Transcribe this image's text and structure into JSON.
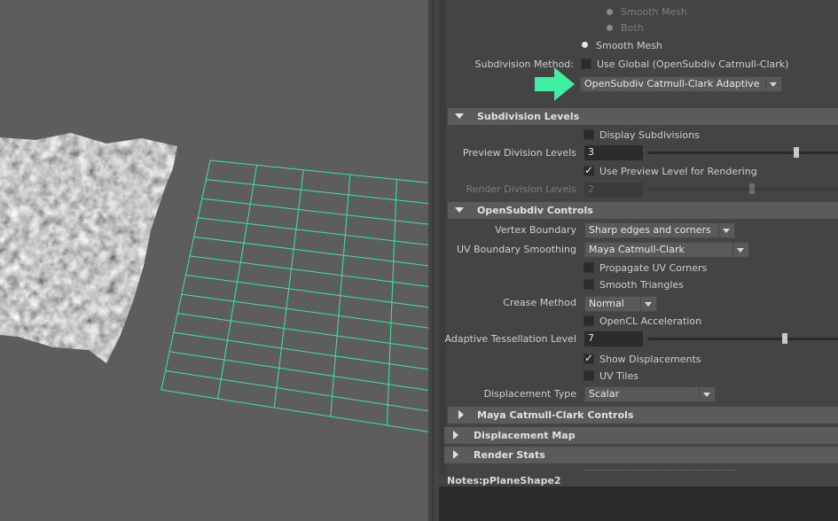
{
  "colors": {
    "wireframe": "#3de6a0",
    "arrow": "#3ff0a0",
    "viewport_bg": "#5d5d5d",
    "panel_bg": "#444444"
  },
  "top_options": {
    "smooth_mesh_dim": "Smooth Mesh",
    "both_dim": "Both",
    "smooth_mesh": "Smooth Mesh"
  },
  "subdivision_method": {
    "label": "Subdivision Method:",
    "use_global_label": "Use Global (OpenSubdiv Catmull-Clark)",
    "use_global_checked": false,
    "selected": "OpenSubdiv Catmull-Clark Adaptive"
  },
  "subdivision_levels": {
    "title": "Subdivision Levels",
    "display_subdivisions_label": "Display Subdivisions",
    "display_subdivisions_checked": false,
    "preview_label": "Preview Division Levels",
    "preview_value": "3",
    "preview_slider_fraction": 0.78,
    "use_preview_label": "Use Preview Level for Rendering",
    "use_preview_checked": true,
    "render_label": "Render Division Levels",
    "render_value": "2",
    "render_slider_fraction": 0.55
  },
  "opensubdiv_controls": {
    "title": "OpenSubdiv Controls",
    "vertex_boundary_label": "Vertex Boundary",
    "vertex_boundary_value": "Sharp edges and corners",
    "uv_boundary_label": "UV Boundary Smoothing",
    "uv_boundary_value": "Maya Catmull-Clark",
    "propagate_uv_label": "Propagate UV Corners",
    "propagate_uv_checked": false,
    "smooth_triangles_label": "Smooth Triangles",
    "smooth_triangles_checked": false,
    "crease_method_label": "Crease Method",
    "crease_method_value": "Normal",
    "opencl_label": "OpenCL Acceleration",
    "opencl_checked": false,
    "adaptive_label": "Adaptive Tessellation Level",
    "adaptive_value": "7",
    "adaptive_slider_fraction": 0.72,
    "show_displacements_label": "Show Displacements",
    "show_displacements_checked": true,
    "uv_tiles_label": "UV Tiles",
    "uv_tiles_checked": false,
    "displacement_type_label": "Displacement Type",
    "displacement_type_value": "Scalar"
  },
  "collapsed_sections": {
    "maya_catmull": "Maya Catmull-Clark Controls",
    "displacement_map": "Displacement Map",
    "render_stats": "Render Stats"
  },
  "notes": {
    "label": "Notes:",
    "value": "pPlaneShape2"
  }
}
